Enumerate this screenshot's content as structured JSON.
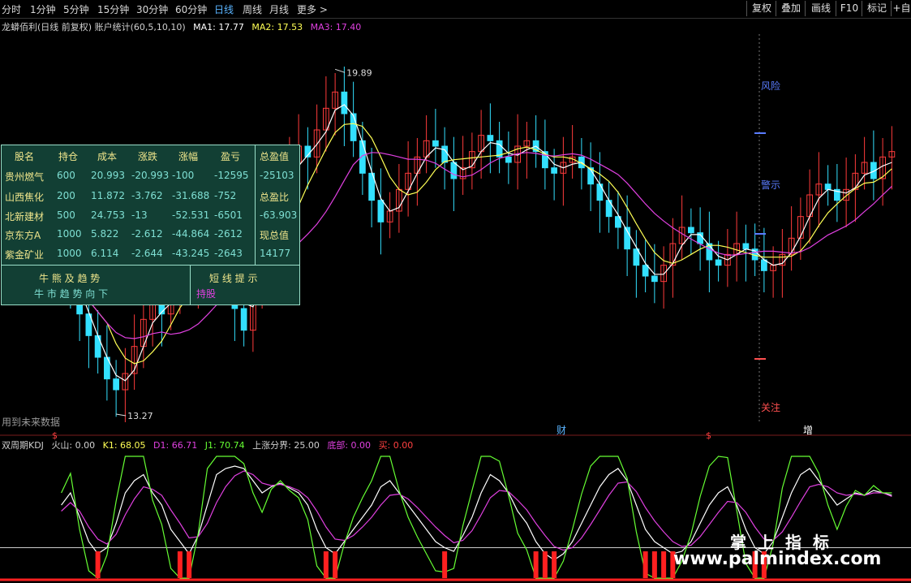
{
  "toolbar": {
    "periods": [
      "分时",
      "1分钟",
      "5分钟",
      "15分钟",
      "30分钟",
      "60分钟",
      "日线",
      "周线",
      "月线",
      "更多 >"
    ],
    "active_period": "日线",
    "buttons": [
      "复权",
      "叠加",
      "画线",
      "F10",
      "标记",
      "+自"
    ]
  },
  "main_legend": {
    "title": "龙蟒佰利(日线 前复权) 账户统计(60,5,10,10)",
    "ma1": "MA1: 17.77",
    "ma2": "MA2: 17.53",
    "ma3": "MA3: 17.40"
  },
  "price_labels": {
    "high": "19.89",
    "low": "13.27"
  },
  "zone_labels": {
    "risk": "风险",
    "warn": "警示",
    "watch": "关注"
  },
  "markers": {
    "cai": "财",
    "s1": "$",
    "s2": "$",
    "zeng": "增"
  },
  "future_note": "用到未来数据",
  "kdj_legend": {
    "title": "双周期KDJ",
    "volcano": "火山: 0.00",
    "k": "K1: 68.05",
    "d": "D1: 66.71",
    "j": "J1: 70.74",
    "rise": "上涨分界: 25.00",
    "bottom": "底部: 0.00",
    "buy": "买: 0.00"
  },
  "holdings": {
    "headers": [
      "股名",
      "持仓",
      "成本",
      "涨跌",
      "涨幅",
      "盈亏"
    ],
    "rows": [
      {
        "name": "贵州燃气",
        "pos": "600",
        "cost": "20.993",
        "chg": "-20.993",
        "pct": "-100",
        "pl": "-12595"
      },
      {
        "name": "山西焦化",
        "pos": "200",
        "cost": "11.872",
        "chg": "-3.762",
        "pct": "-31.688",
        "pl": "-752"
      },
      {
        "name": "北新建材",
        "pos": "500",
        "cost": "24.753",
        "chg": "-13",
        "pct": "-52.531",
        "pl": "-6501"
      },
      {
        "name": "京东方A",
        "pos": "1000",
        "cost": "5.822",
        "chg": "-2.612",
        "pct": "-44.864",
        "pl": "-2612"
      },
      {
        "name": "紫金矿业",
        "pos": "1000",
        "cost": "6.114",
        "chg": "-2.644",
        "pct": "-43.245",
        "pl": "-2643"
      }
    ],
    "summary": {
      "total_pl_label": "总盈值",
      "total_pl": "-25103",
      "total_ratio_label": "总盈比",
      "total_ratio": "-63.903",
      "total_value_label": "现总值",
      "total_value": "14177"
    },
    "trend_title": "牛 熊 及 趋 势",
    "trend_text": "牛 市 趋 势 向 下",
    "tip_title": "短 线 提 示",
    "tip_text": "持股"
  },
  "watermark": {
    "cn": "掌上指标",
    "url": "www.palmindex.com"
  },
  "colors": {
    "up": "#ff3b3b",
    "down": "#33e0ff",
    "ma1": "#ffffff",
    "ma2": "#ffff55",
    "ma3": "#e040e0",
    "k": "#ffffff",
    "d": "#ffff55",
    "j": "#66ff33",
    "kdj_ma": "#e040e0",
    "bar": "#ff2020"
  },
  "chart_data": {
    "type": "candlestick",
    "ylim": [
      13.0,
      20.2
    ],
    "close": [
      15.9,
      15.5,
      15.0,
      14.6,
      14.2,
      13.8,
      13.6,
      13.9,
      14.4,
      14.9,
      15.2,
      15.0,
      15.4,
      15.8,
      15.7,
      15.9,
      16.2,
      16.0,
      15.8,
      15.1,
      14.7,
      15.6,
      16.4,
      16.8,
      17.3,
      17.8,
      18.1,
      17.9,
      18.4,
      18.8,
      19.1,
      18.7,
      18.2,
      17.6,
      17.1,
      16.7,
      16.9,
      17.3,
      17.6,
      17.9,
      18.2,
      18.1,
      17.8,
      17.5,
      17.7,
      18.0,
      18.3,
      18.2,
      17.9,
      17.8,
      18.1,
      18.2,
      18.0,
      17.7,
      17.6,
      17.8,
      17.9,
      17.7,
      17.4,
      17.1,
      16.8,
      16.6,
      16.2,
      15.9,
      15.7,
      15.6,
      15.9,
      16.3,
      16.6,
      16.5,
      16.3,
      16.0,
      15.9,
      16.1,
      16.3,
      16.2,
      16.0,
      15.8,
      15.9,
      16.1,
      16.4,
      16.8,
      17.2,
      17.4,
      17.3,
      17.1,
      17.3,
      17.6,
      17.8,
      17.5,
      17.9,
      18.0
    ],
    "kdj_ylim": [
      0,
      100
    ],
    "k": [
      60,
      70,
      50,
      30,
      20,
      25,
      45,
      70,
      80,
      85,
      70,
      60,
      40,
      30,
      20,
      35,
      60,
      85,
      90,
      92,
      90,
      80,
      70,
      75,
      78,
      74,
      70,
      60,
      40,
      25,
      20,
      30,
      40,
      50,
      60,
      75,
      80,
      70,
      60,
      50,
      40,
      30,
      25,
      22,
      35,
      50,
      70,
      85,
      80,
      70,
      55,
      45,
      30,
      20,
      15,
      20,
      30,
      45,
      60,
      75,
      85,
      90,
      80,
      60,
      40,
      30,
      25,
      20,
      22,
      30,
      45,
      60,
      70,
      75,
      60,
      40,
      25,
      20,
      30,
      50,
      70,
      85,
      90,
      80,
      70,
      60,
      65,
      70,
      68,
      72,
      70,
      68
    ],
    "d": [
      55,
      62,
      55,
      42,
      32,
      28,
      36,
      52,
      65,
      75,
      73,
      68,
      56,
      45,
      33,
      34,
      45,
      62,
      75,
      84,
      88,
      85,
      78,
      76,
      77,
      75,
      72,
      66,
      55,
      42,
      32,
      31,
      35,
      42,
      50,
      60,
      68,
      69,
      65,
      58,
      50,
      42,
      35,
      29,
      31,
      39,
      52,
      66,
      72,
      71,
      64,
      56,
      45,
      35,
      26,
      23,
      25,
      33,
      44,
      56,
      68,
      78,
      79,
      71,
      58,
      47,
      38,
      30,
      26,
      27,
      34,
      44,
      54,
      63,
      62,
      54,
      42,
      32,
      31,
      38,
      50,
      63,
      75,
      77,
      75,
      70,
      68,
      69,
      68,
      70,
      70,
      67
    ],
    "j": [
      70,
      86,
      40,
      6,
      0,
      19,
      63,
      100,
      100,
      100,
      64,
      44,
      8,
      0,
      0,
      37,
      90,
      100,
      100,
      100,
      94,
      70,
      54,
      73,
      80,
      72,
      66,
      48,
      10,
      0,
      0,
      28,
      50,
      66,
      80,
      100,
      100,
      72,
      50,
      34,
      20,
      6,
      5,
      8,
      43,
      72,
      100,
      100,
      96,
      68,
      37,
      23,
      0,
      0,
      0,
      14,
      40,
      69,
      92,
      100,
      100,
      100,
      82,
      38,
      4,
      0,
      0,
      0,
      14,
      36,
      67,
      92,
      100,
      99,
      56,
      12,
      0,
      0,
      28,
      74,
      100,
      100,
      100,
      86,
      60,
      40,
      59,
      72,
      68,
      76,
      70,
      70
    ]
  }
}
